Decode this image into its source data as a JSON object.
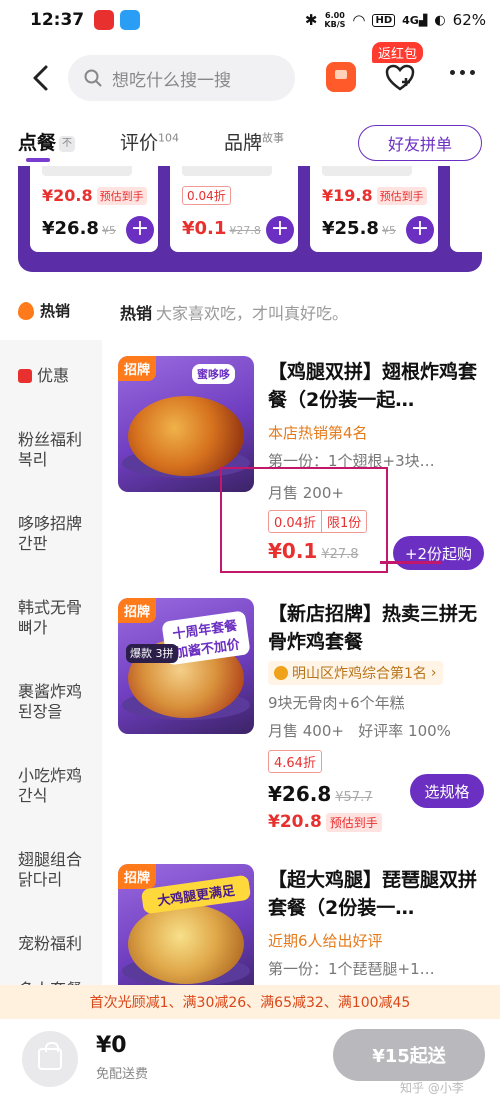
{
  "status": {
    "time": "12:37",
    "net_speed_value": "6.00",
    "net_speed_unit": "KB/S",
    "hd": "HD",
    "signal": "4G",
    "battery": "62%"
  },
  "header": {
    "search_placeholder": "想吃什么搜一搜",
    "hongbao_label": "返红包"
  },
  "tabs": {
    "order": "点餐",
    "order_fold": "不",
    "review": "评价",
    "review_count": "104",
    "brand": "品牌",
    "brand_sup": "故事",
    "group_order": "好友拼单"
  },
  "recommend": [
    {
      "top_price": "¥20.8",
      "top_tag": "预估到手",
      "price": "¥26.8",
      "orig": "¥5"
    },
    {
      "top_disc": "0.04折",
      "price": "¥0.1",
      "orig": "¥27.8"
    },
    {
      "top_price": "¥19.8",
      "top_tag": "预估到手",
      "price": "¥25.8",
      "orig": "¥5"
    }
  ],
  "section": {
    "left_label": "热销",
    "title": "热销",
    "subtitle": "大家喜欢吃，才叫真好吃。"
  },
  "sidebar": [
    {
      "label": "优惠"
    },
    {
      "label": "粉丝福利\n복리"
    },
    {
      "label": "哆哆招牌\n간판"
    },
    {
      "label": "韩式无骨\n뼈가"
    },
    {
      "label": "裹酱炸鸡\n된장을"
    },
    {
      "label": "小吃炸鸡\n간식"
    },
    {
      "label": "翅腿组合\n닭다리"
    },
    {
      "label": "宠粉福利"
    },
    {
      "label": "多人套餐"
    }
  ],
  "products": [
    {
      "badge": "招牌",
      "img_ribbon": "蜜哆哆",
      "title": "【鸡腿双拼】翅根炸鸡套餐（2份装一起…",
      "rank": "本店热销第4名",
      "desc": "第一份：1个翅根+3块…",
      "sales": "月售 200+",
      "disc": "0.04折",
      "limit": "限1份",
      "price": "¥0.1",
      "orig": "¥27.8",
      "action": "+2份起购"
    },
    {
      "badge": "招牌",
      "img_banner": "十周年套餐 加酱不加价",
      "img_tag": "爆款 3拼",
      "title": "【新店招牌】热卖三拼无骨炸鸡套餐",
      "rank": "明山区炸鸡综合第1名",
      "desc": "9块无骨肉+6个年糕",
      "sales": "月售 400+",
      "rating": "好评率 100%",
      "disc": "4.64折",
      "price": "¥26.8",
      "orig": "¥57.7",
      "est_price": "¥20.8",
      "est_tag": "预估到手",
      "action": "选规格"
    },
    {
      "badge": "招牌",
      "img_banner": "大鸡腿更满足",
      "title": "【超大鸡腿】琵琶腿双拼套餐（2份装一…",
      "rank": "近期6人给出好评",
      "desc": "第一份：1个琵琶腿+1…"
    }
  ],
  "promo": "首次光顾减1、满30减26、满65减32、满100减45",
  "bottom": {
    "total": "¥0",
    "delivery": "免配送费",
    "checkout": "¥15起送",
    "watermark": "知乎 @小李"
  },
  "colors": {
    "brand_purple": "#6b2fc2",
    "price_red": "#e8302f",
    "highlight": "#c2176b"
  }
}
